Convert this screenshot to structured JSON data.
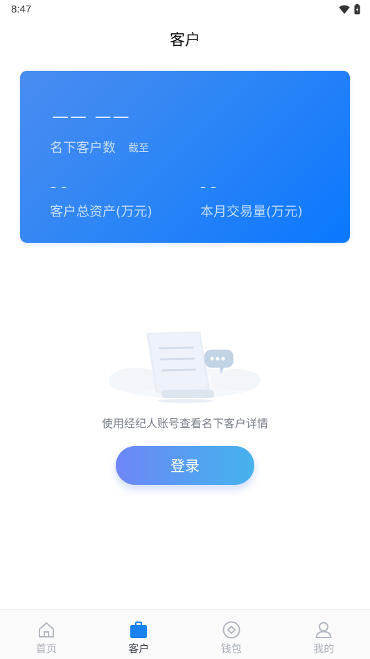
{
  "status_bar": {
    "time": "8:47"
  },
  "header": {
    "title": "客户"
  },
  "summary_card": {
    "customer_count_value": "—— ——",
    "customer_count_label": "名下客户数",
    "as_of_label": "截至",
    "total_assets_value": "– –",
    "total_assets_label": "客户总资产(万元)",
    "monthly_volume_value": "– –",
    "monthly_volume_label": "本月交易量(万元)"
  },
  "empty_state": {
    "hint": "使用经纪人账号查看名下客户详情"
  },
  "login_button": {
    "label": "登录"
  },
  "tab_bar": {
    "items": [
      {
        "label": "首页",
        "icon": "home-icon",
        "active": false
      },
      {
        "label": "客户",
        "icon": "briefcase-icon",
        "active": true
      },
      {
        "label": "钱包",
        "icon": "wallet-icon",
        "active": false
      },
      {
        "label": "我的",
        "icon": "person-icon",
        "active": false
      }
    ]
  },
  "colors": {
    "card_gradient_start": "#4a8cf0",
    "card_gradient_end": "#0a77ff",
    "button_gradient_start": "#6e86f7",
    "button_gradient_end": "#45b2ec",
    "active_tab_icon": "#1a82f0"
  }
}
